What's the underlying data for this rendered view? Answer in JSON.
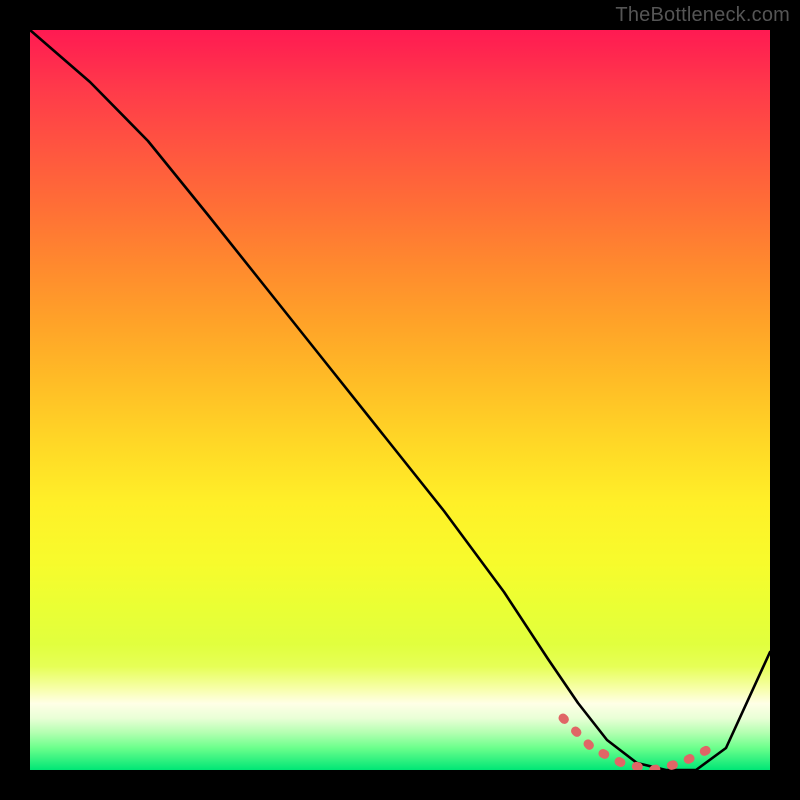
{
  "watermark": "TheBottleneck.com",
  "colors": {
    "curve": "#000000",
    "dash": "#e06666",
    "frame": "#000000"
  },
  "chart_data": {
    "type": "line",
    "title": "",
    "xlabel": "",
    "ylabel": "",
    "xlim": [
      0,
      100
    ],
    "ylim": [
      0,
      100
    ],
    "grid": false,
    "legend": false,
    "series": [
      {
        "name": "bottleneck-curve",
        "x": [
          0,
          8,
          16,
          24,
          32,
          40,
          48,
          56,
          64,
          70,
          74,
          78,
          82,
          86,
          90,
          94,
          100
        ],
        "y": [
          100,
          93,
          85,
          75,
          65,
          55,
          45,
          35,
          24,
          15,
          9,
          4,
          1,
          0,
          0,
          3,
          16
        ]
      },
      {
        "name": "sweet-spot-band",
        "x": [
          72,
          76,
          80,
          84,
          88,
          92
        ],
        "y": [
          7,
          3,
          1,
          0,
          1,
          3
        ]
      }
    ],
    "annotations": []
  }
}
